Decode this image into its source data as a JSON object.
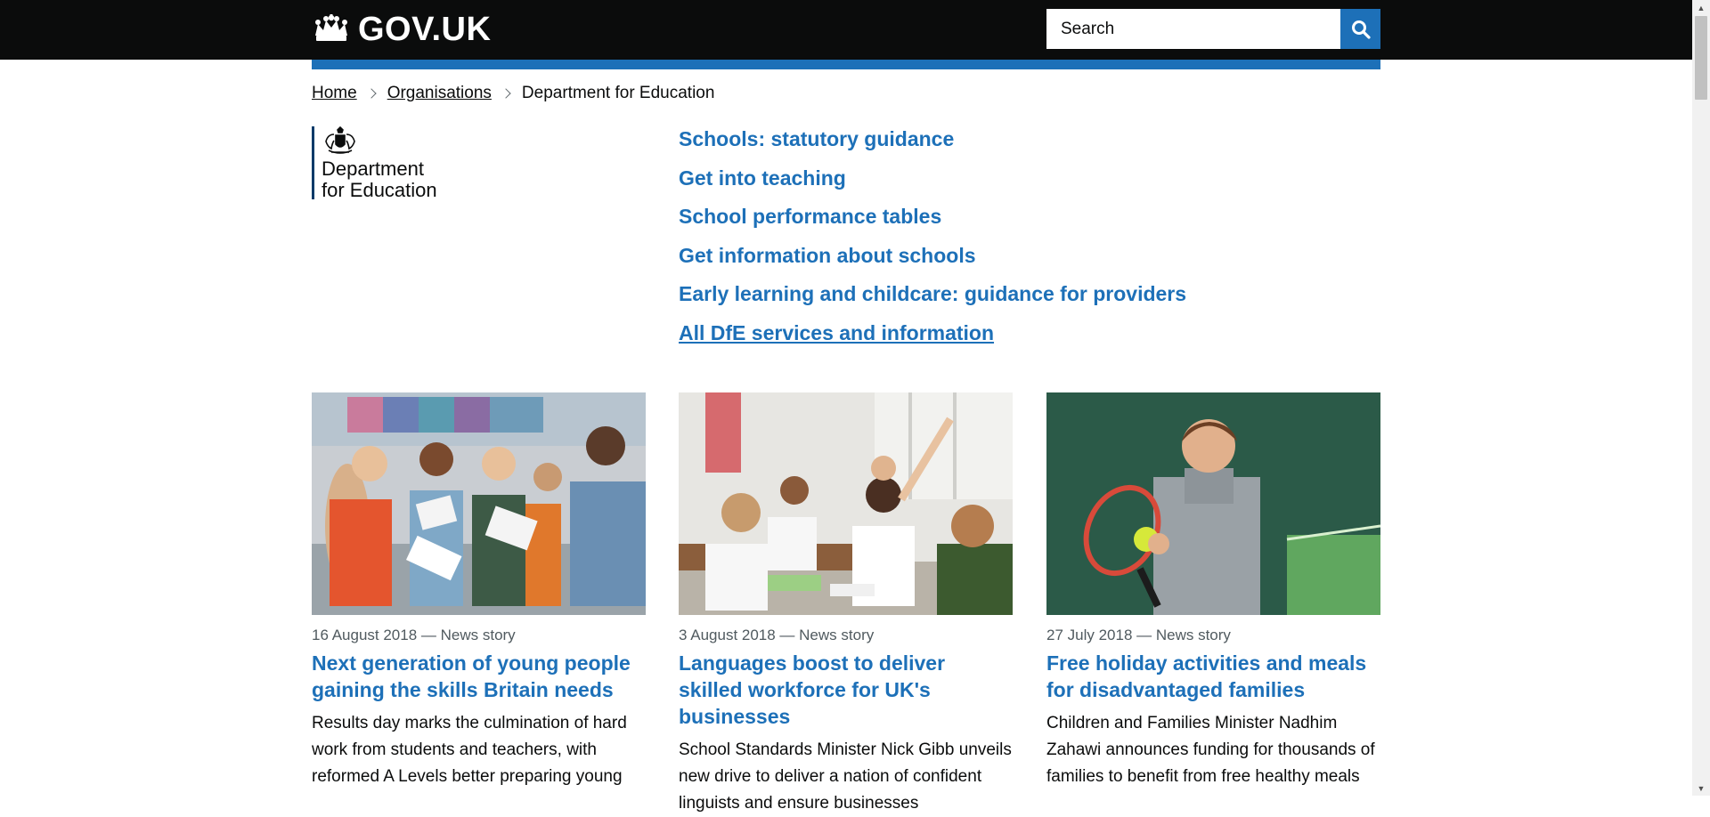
{
  "header": {
    "logo_text": "GOV.UK",
    "search_placeholder": "Search",
    "search_button_label": "Search GOV.UK"
  },
  "breadcrumb": {
    "items": [
      "Home",
      "Organisations"
    ],
    "current": "Department for Education"
  },
  "organisation": {
    "name_line1": "Department",
    "name_line2": "for Education"
  },
  "featured_links": [
    "Schools: statutory guidance",
    "Get into teaching",
    "School performance tables",
    "Get information about schools",
    "Early learning and childcare: guidance for providers",
    "All DfE services and information"
  ],
  "news": [
    {
      "meta": "16 August 2018 — News story",
      "title": "Next generation of young people gaining the skills Britain needs",
      "description": "Results day marks the culmination of hard work from students and teachers, with reformed A Levels better preparing young"
    },
    {
      "meta": "3 August 2018 — News story",
      "title": "Languages boost to deliver skilled workforce for UK's businesses",
      "description": "School Standards Minister Nick Gibb unveils new drive to deliver a nation of confident linguists and ensure businesses"
    },
    {
      "meta": "27 July 2018 — News story",
      "title": "Free holiday activities and meals for disadvantaged families",
      "description": "Children and Families Minister Nadhim Zahawi announces funding for thousands of families to benefit from free healthy meals"
    }
  ],
  "icons": {
    "crown": "crown-icon",
    "search": "search-icon",
    "crest": "royal-arms-icon"
  },
  "colors": {
    "header_bg": "#0b0c0c",
    "brand_blue": "#1d70b8",
    "link_blue": "#1d70b8",
    "meta_grey": "#505a5f"
  }
}
